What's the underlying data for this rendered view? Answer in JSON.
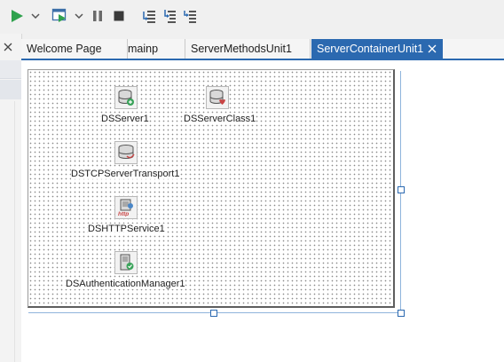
{
  "toolbar": {
    "buttons": [
      {
        "name": "run-icon"
      },
      {
        "name": "dropdown-arrow-icon"
      },
      {
        "name": "run-without-debug-icon"
      },
      {
        "name": "dropdown-arrow-icon"
      },
      {
        "name": "pause-icon"
      },
      {
        "name": "stop-icon"
      },
      {
        "name": "step-over-icon"
      },
      {
        "name": "trace-into-icon"
      },
      {
        "name": "run-to-cursor-icon"
      }
    ]
  },
  "tabs": [
    {
      "label": "Welcome Page",
      "active": false
    },
    {
      "label": "mainp",
      "active": false
    },
    {
      "label": "ServerMethodsUnit1",
      "active": false
    },
    {
      "label": "ServerContainerUnit1",
      "active": true
    }
  ],
  "components": [
    {
      "label": "DSServer1",
      "icon": "database-server-icon"
    },
    {
      "label": "DSServerClass1",
      "icon": "database-class-icon"
    },
    {
      "label": "DSTCPServerTransport1",
      "icon": "database-transport-icon"
    },
    {
      "label": "DSHTTPService1",
      "icon": "http-service-icon"
    },
    {
      "label": "DSAuthenticationManager1",
      "icon": "authentication-manager-icon"
    }
  ],
  "colors": {
    "accent": "#2b69b0",
    "run_green": "#2fa24d",
    "toolbar_bg": "#f0f0f0",
    "editor_bg": "#ffffff"
  }
}
